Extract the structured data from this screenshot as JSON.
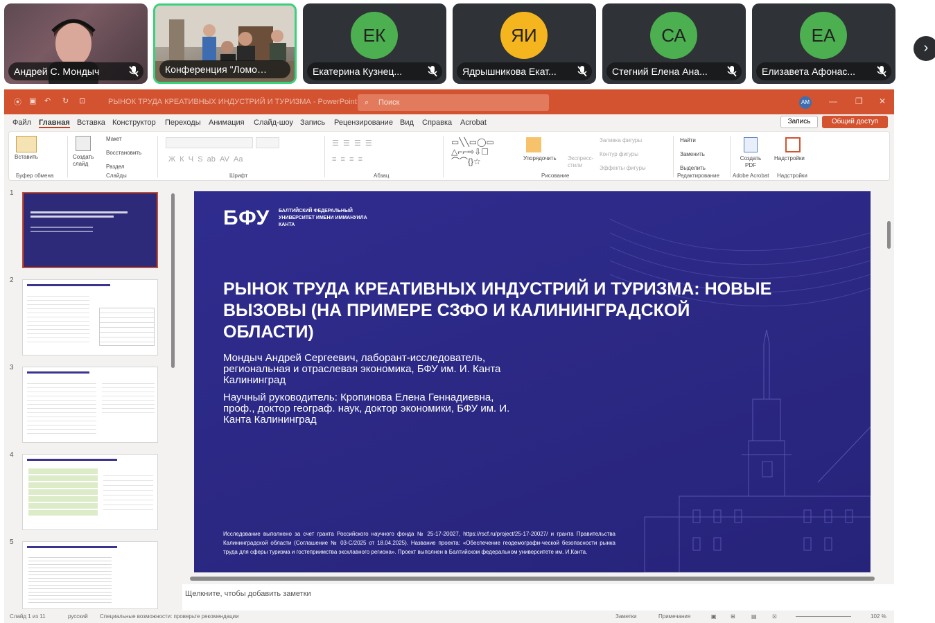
{
  "participants": [
    {
      "name": "Андрей С. Мондыч",
      "initials": ""
    },
    {
      "name": "Конференция \"Ломон...",
      "initials": ""
    },
    {
      "name": "Екатерина Кузнец...",
      "initials": "ЕК",
      "color": "#4caf50"
    },
    {
      "name": "Ядрышникова Екат...",
      "initials": "ЯИ",
      "color": "#f5b51e"
    },
    {
      "name": "Стегний Елена Ана...",
      "initials": "СА",
      "color": "#4caf50"
    },
    {
      "name": "Елизавета Афонас...",
      "initials": "ЕА",
      "color": "#4caf50"
    }
  ],
  "next_icon": "›",
  "ppt": {
    "window_title": "РЫНОК ТРУДА КРЕАТИВНЫХ ИНДУСТРИЙ И ТУРИЗМА - PowerPoint",
    "search_placeholder": "Поиск",
    "account_initials": "AM",
    "menu": [
      "Файл",
      "Главная",
      "Вставка",
      "Конструктор",
      "Переходы",
      "Анимация",
      "Слайд-шоу",
      "Запись",
      "Рецензирование",
      "Вид",
      "Справка",
      "Acrobat"
    ],
    "record_button": "Запись",
    "share_button": "Общий доступ",
    "ribbon": {
      "paste": "Вставить",
      "clipboard": "Буфер обмена",
      "new_slide": "Создать слайд",
      "layout": "Макет",
      "reset": "Восстановить",
      "section": "Раздел",
      "slides": "Слайды",
      "font": "Шрифт",
      "paragraph": "Абзац",
      "arrange": "Упорядочить",
      "quick_styles": "Экспресс-стили",
      "shape_fill": "Заливка фигуры",
      "shape_outline": "Контур фигуры",
      "shape_effects": "Эффекты фигуры",
      "drawing": "Рисование",
      "find": "Найти",
      "replace": "Заменить",
      "select": "Выделить",
      "editing": "Редактирование",
      "create_pdf": "Создать PDF",
      "adobe": "Adobe Acrobat",
      "addins": "Надстройки",
      "addins_group": "Надстройки"
    },
    "slide_numbers": [
      "1",
      "2",
      "3",
      "4",
      "5"
    ],
    "slide": {
      "logo": "БФУ",
      "logo_text": "БАЛТИЙСКИЙ ФЕДЕРАЛЬНЫЙ УНИВЕРСИТЕТ ИМЕНИ ИММАНУИЛА КАНТА",
      "title": "РЫНОК ТРУДА КРЕАТИВНЫХ ИНДУСТРИЙ И ТУРИЗМА: НОВЫЕ ВЫЗОВЫ (НА ПРИМЕРЕ СЗФО И КАЛИНИНГРАДСКОЙ ОБЛАСТИ)",
      "author": "Мондыч Андрей Сергеевич, лаборант-исследователь, региональная и отраслевая экономика, БФУ им. И. Канта Калининград",
      "supervisor": "Научный руководитель: Кропинова Елена Геннадиевна, проф., доктор географ. наук, доктор экономики, БФУ им. И. Канта Калининград",
      "grant": "Исследование выполнено за счет гранта Российского научного фонда № 25-17-20027, https://rscf.ru/project/25-17-20027/ и гранта Правительства Калининградской области (Соглашение № 03-С/2025 от 18.04.2025). Название проекта: «Обеспечение геодемографи-ческой безопасности рынка труда для сферы туризма и гостеприимства эксклавного региона». Проект выполнен в Балтийском федеральном университете им. И.Канта."
    },
    "notes_placeholder": "Щелкните, чтобы добавить заметки",
    "status": {
      "slide_of": "Слайд 1 из 11",
      "language": "русский",
      "accessibility": "Специальные возможности: проверьте рекомендации",
      "notes": "Заметки",
      "comments": "Примечания",
      "zoom": "102 %"
    }
  }
}
